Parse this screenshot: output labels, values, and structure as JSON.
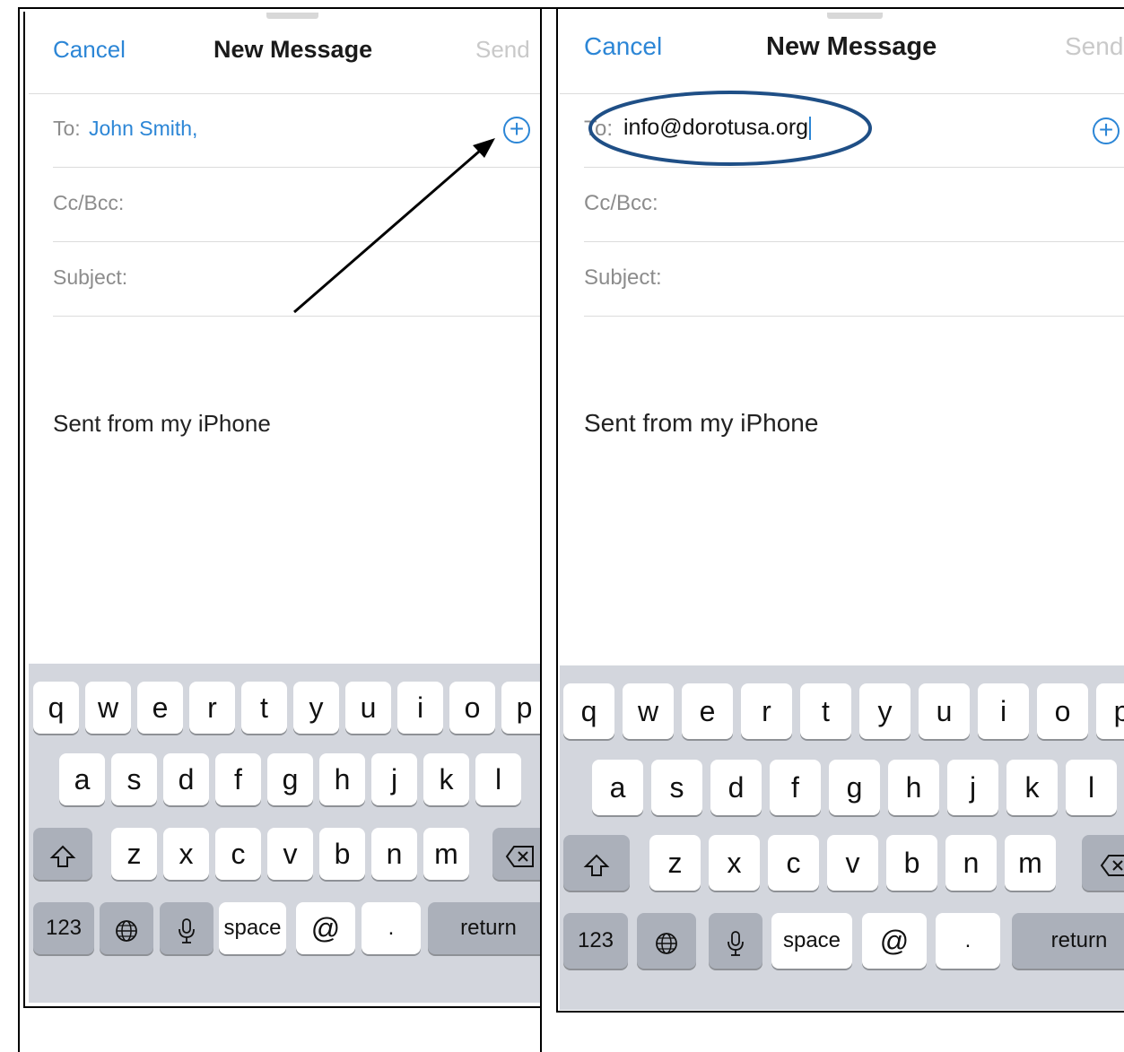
{
  "left": {
    "nav": {
      "cancel": "Cancel",
      "title": "New Message",
      "send": "Send"
    },
    "to": {
      "label": "To:",
      "value": "John Smith,"
    },
    "cc": {
      "label": "Cc/Bcc:"
    },
    "subject": {
      "label": "Subject:"
    },
    "body": {
      "signature": "Sent from my iPhone"
    }
  },
  "right": {
    "nav": {
      "cancel": "Cancel",
      "title": "New Message",
      "send": "Send"
    },
    "to": {
      "label": "To:",
      "value": "info@dorotusa.org"
    },
    "cc": {
      "label": "Cc/Bcc:"
    },
    "subject": {
      "label": "Subject:"
    },
    "body": {
      "signature": "Sent from my iPhone"
    }
  },
  "keyboard": {
    "row1": [
      "q",
      "w",
      "e",
      "r",
      "t",
      "y",
      "u",
      "i",
      "o",
      "p"
    ],
    "row2": [
      "a",
      "s",
      "d",
      "f",
      "g",
      "h",
      "j",
      "k",
      "l"
    ],
    "row3": [
      "z",
      "x",
      "c",
      "v",
      "b",
      "n",
      "m"
    ],
    "numbers": "123",
    "space": "space",
    "at": "@",
    "dot": ".",
    "return": "return"
  },
  "icons": {
    "add_contact": "plus-circle-icon",
    "shift": "shift-icon",
    "delete": "backspace-icon",
    "globe": "globe-icon",
    "mic": "microphone-icon",
    "arrow": "arrow-annotation",
    "highlight": "ellipse-annotation"
  },
  "colors": {
    "accent": "#2c86d6",
    "disabled_send": "#c9c9c9",
    "keyboard_bg": "#d3d6dd",
    "key_dark": "#abb0ba",
    "annotation_ellipse": "#1f4f86"
  }
}
